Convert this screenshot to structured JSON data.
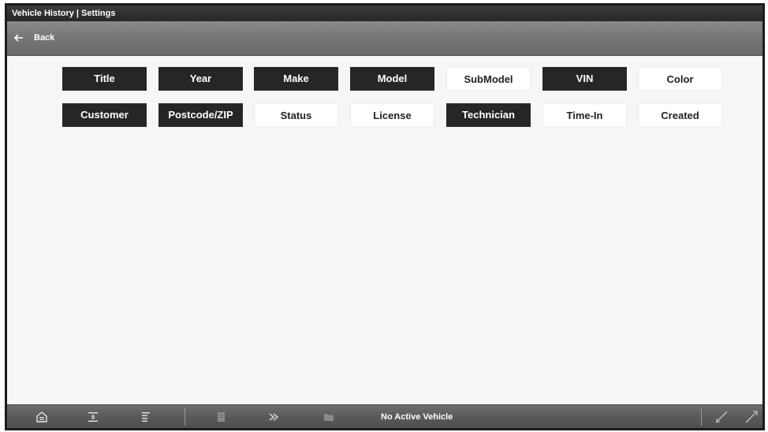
{
  "window": {
    "title": "Vehicle History | Settings"
  },
  "nav": {
    "back_label": "Back"
  },
  "fields": [
    {
      "label": "Title",
      "selected": true
    },
    {
      "label": "Year",
      "selected": true
    },
    {
      "label": "Make",
      "selected": true
    },
    {
      "label": "Model",
      "selected": true
    },
    {
      "label": "SubModel",
      "selected": false
    },
    {
      "label": "VIN",
      "selected": true
    },
    {
      "label": "Color",
      "selected": false
    },
    {
      "label": "Customer",
      "selected": true
    },
    {
      "label": "Postcode/ZIP",
      "selected": true
    },
    {
      "label": "Status",
      "selected": false
    },
    {
      "label": "License",
      "selected": false
    },
    {
      "label": "Technician",
      "selected": true
    },
    {
      "label": "Time-In",
      "selected": false
    },
    {
      "label": "Created",
      "selected": false
    }
  ],
  "toolbar": {
    "status_text": "No Active Vehicle",
    "icons": [
      "home-icon",
      "scroll-up-down-icon",
      "list-view-icon",
      "data-list-icon",
      "shortcut-icon",
      "folder-icon",
      "zoom-icon",
      "settings-icon"
    ]
  },
  "colors": {
    "selected_bg": "#262626",
    "unselected_bg": "#ffffff",
    "toolbar_bg": "#5a5a5a"
  }
}
